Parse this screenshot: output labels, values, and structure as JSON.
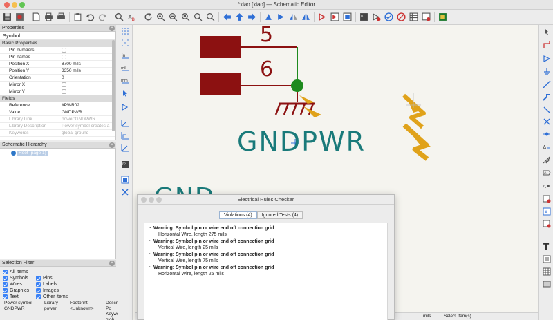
{
  "window": {
    "title": "*xiao [xiao] — Schematic Editor"
  },
  "properties": {
    "header": "Properties",
    "subtitle": "Symbol",
    "basic_group": "Basic Properties",
    "basic": [
      {
        "name": "Pin numbers",
        "value": "",
        "checkbox": true
      },
      {
        "name": "Pin names",
        "value": "",
        "checkbox": true
      },
      {
        "name": "Position X",
        "value": "8700 mils"
      },
      {
        "name": "Position Y",
        "value": "3350 mils"
      },
      {
        "name": "Orientation",
        "value": "0"
      },
      {
        "name": "Mirror X",
        "value": "",
        "checkbox": true
      },
      {
        "name": "Mirror Y",
        "value": "",
        "checkbox": true
      }
    ],
    "fields_group": "Fields",
    "fields": [
      {
        "name": "Reference",
        "value": "#PWR02"
      },
      {
        "name": "Value",
        "value": "GNDPWR"
      },
      {
        "name": "Library Link",
        "value": "power:GNDPWR",
        "dim": true
      },
      {
        "name": "Library Description",
        "value": "Power symbol creates a",
        "dim": true
      },
      {
        "name": "Keywords",
        "value": "global ground",
        "dim": true
      }
    ]
  },
  "hierarchy": {
    "header": "Schematic Hierarchy",
    "root_label": "Root (page 1)"
  },
  "selection_filter": {
    "header": "Selection Filter",
    "left": [
      "All items",
      "Symbols",
      "Wires",
      "Graphics",
      "Text"
    ],
    "right": [
      "Pins",
      "Labels",
      "Images",
      "Other items"
    ]
  },
  "messages": {
    "cols": [
      {
        "label": "Power symbol",
        "value": "GNDPWR"
      },
      {
        "label": "Library",
        "value": "power"
      },
      {
        "label": "Footprint",
        "value": "<Unknown>"
      },
      {
        "label": "Description: Po",
        "value": "Keywords: glob"
      }
    ]
  },
  "canvas": {
    "pin5": "5",
    "pin6": "6",
    "gnd_label": "GNDPWR",
    "partial_label": "GND"
  },
  "statusbar": {
    "units": "mils",
    "selected": "Select item(s)"
  },
  "erc": {
    "title": "Electrical Rules Checker",
    "tab_violations": "Violations (4)",
    "tab_ignored": "Ignored Tests (4)",
    "items": [
      {
        "warning": "Warning: Symbol pin or wire end off connection grid",
        "detail": "Horizontal Wire, length 275 mils"
      },
      {
        "warning": "Warning: Symbol pin or wire end off connection grid",
        "detail": "Vertical Wire, length 25 mils"
      },
      {
        "warning": "Warning: Symbol pin or wire end off connection grid",
        "detail": "Vertical Wire, length 75 mils"
      },
      {
        "warning": "Warning: Symbol pin or wire end off connection grid",
        "detail": "Horizontal Wire, length 25 mils"
      }
    ]
  },
  "colors": {
    "pin_body": "#8c1111",
    "wire": "#1e8a1e",
    "junction": "#1e8a1e",
    "label": "#1a7a7a",
    "marker": "#e0a21a"
  }
}
